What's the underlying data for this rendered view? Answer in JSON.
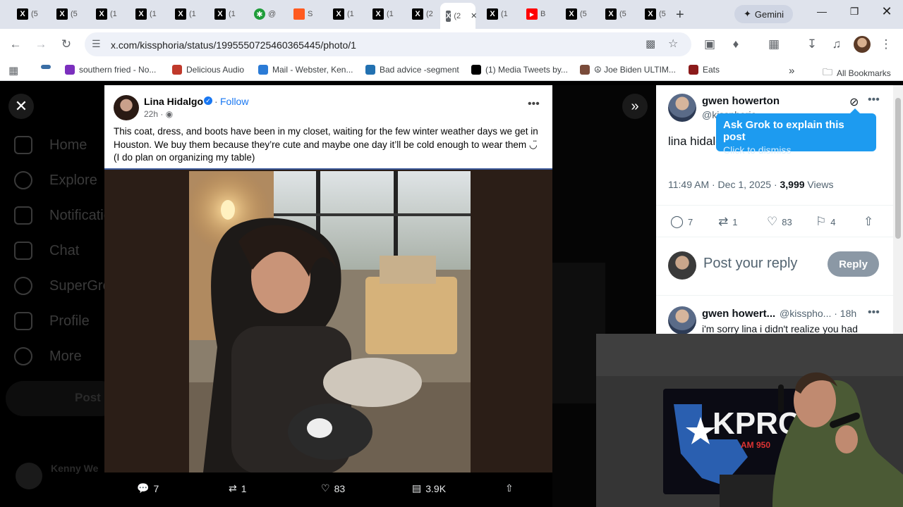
{
  "browser": {
    "tabs": [
      {
        "label": "(5",
        "favicon": "x-logo"
      },
      {
        "label": "(5",
        "favicon": "x-logo"
      },
      {
        "label": "(1",
        "favicon": "x-logo"
      },
      {
        "label": "(1",
        "favicon": "x-logo"
      },
      {
        "label": "(1",
        "favicon": "x-logo"
      },
      {
        "label": "(1",
        "favicon": "x-logo"
      },
      {
        "label": "@",
        "favicon": "green-app"
      },
      {
        "label": "S",
        "favicon": "orange-app"
      },
      {
        "label": "(1",
        "favicon": "x-logo"
      },
      {
        "label": "(1",
        "favicon": "x-logo"
      },
      {
        "label": "(2",
        "favicon": "x-logo"
      },
      {
        "label": "(2",
        "favicon": "x-logo",
        "active": true
      },
      {
        "label": "(1",
        "favicon": "x-logo"
      },
      {
        "label": "B",
        "favicon": "youtube"
      },
      {
        "label": "(5",
        "favicon": "x-logo"
      },
      {
        "label": "(5",
        "favicon": "x-logo"
      },
      {
        "label": "(5",
        "favicon": "x-logo"
      }
    ],
    "gemini_label": "Gemini",
    "url": "x.com/kissphoria/status/1995550725460365445/photo/1",
    "bookmarks": [
      {
        "label": "southern fried - No...",
        "color": "#7b2fbe"
      },
      {
        "label": "Delicious Audio",
        "color": "#c0392b"
      },
      {
        "label": "Mail - Webster, Ken...",
        "color": "#2b7bd6"
      },
      {
        "label": "Bad advice -segment",
        "color": "#2271b1"
      },
      {
        "label": "(1) Media Tweets by...",
        "color": "#000000"
      },
      {
        "label": "☮ Joe Biden ULTIM...",
        "color": "#7a4b3a"
      },
      {
        "label": "Eats",
        "color": "#8b1a1a"
      }
    ],
    "all_bookmarks_label": "All Bookmarks"
  },
  "sidebar": {
    "items": [
      "Home",
      "Explore",
      "Notifications",
      "Chat",
      "SuperGrok",
      "Profile",
      "More"
    ],
    "post_label": "Post",
    "account_name": "Kenny We"
  },
  "facebook_post": {
    "author": "Lina Hidalgo",
    "follow_label": "Follow",
    "time": "22h",
    "text": "This coat, dress, and boots have been in my closet, waiting for the few winter weather days we get in Houston. We buy them because they’re cute and maybe one day it’ll be cold enough to wear them ◡̈ (I do plan on organizing my table)"
  },
  "photo_bar": {
    "replies": "7",
    "reposts": "1",
    "likes": "83",
    "views": "3.9K"
  },
  "tweet": {
    "name": "gwen howerton",
    "handle": "@kissphoria",
    "text": "lina hidalgo posted this on facebook",
    "time": "11:49 AM · Dec 1, 2025 · ",
    "views_count": "3,999",
    "views_label": " Views",
    "replies": "7",
    "reposts": "1",
    "likes": "83",
    "bookmarks": "4",
    "reply_placeholder": "Post your reply",
    "reply_button": "Reply"
  },
  "reply_tweet": {
    "name": "gwen howert...",
    "handle": "@kisspho... · 18h",
    "text": "i'm sorry lina i didn't realize you had"
  },
  "grok_popup": {
    "title": "Ask Grok to explain this post",
    "dismiss": "Click to dismiss"
  },
  "webcam": {
    "station_sign": "KPRC",
    "station_sub": "AM 950"
  }
}
